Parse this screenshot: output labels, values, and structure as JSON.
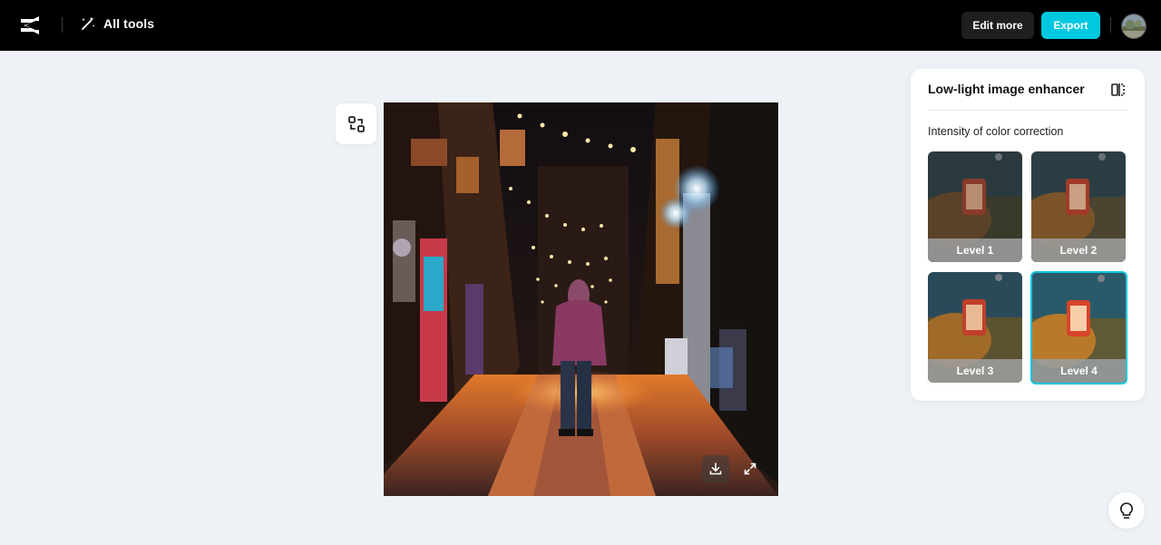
{
  "header": {
    "logo_icon": "capcut-logo-icon",
    "all_tools_label": "All tools",
    "all_tools_icon": "magic-wand-icon",
    "edit_more_label": "Edit more",
    "export_label": "Export",
    "avatar_icon": "user-avatar"
  },
  "canvas": {
    "compare_icon": "compare-swap-icon",
    "download_icon": "download-icon",
    "fullscreen_icon": "expand-icon"
  },
  "panel": {
    "title": "Low-light image enhancer",
    "compare_icon": "split-compare-icon",
    "intensity_label": "Intensity of color correction",
    "levels": [
      {
        "label": "Level 1",
        "selected": false
      },
      {
        "label": "Level 2",
        "selected": false
      },
      {
        "label": "Level 3",
        "selected": false
      },
      {
        "label": "Level 4",
        "selected": true
      }
    ]
  },
  "help": {
    "icon": "lightbulb-icon"
  },
  "colors": {
    "accent": "#00c8e0",
    "topbar": "#000000",
    "background": "#eef2f6"
  }
}
